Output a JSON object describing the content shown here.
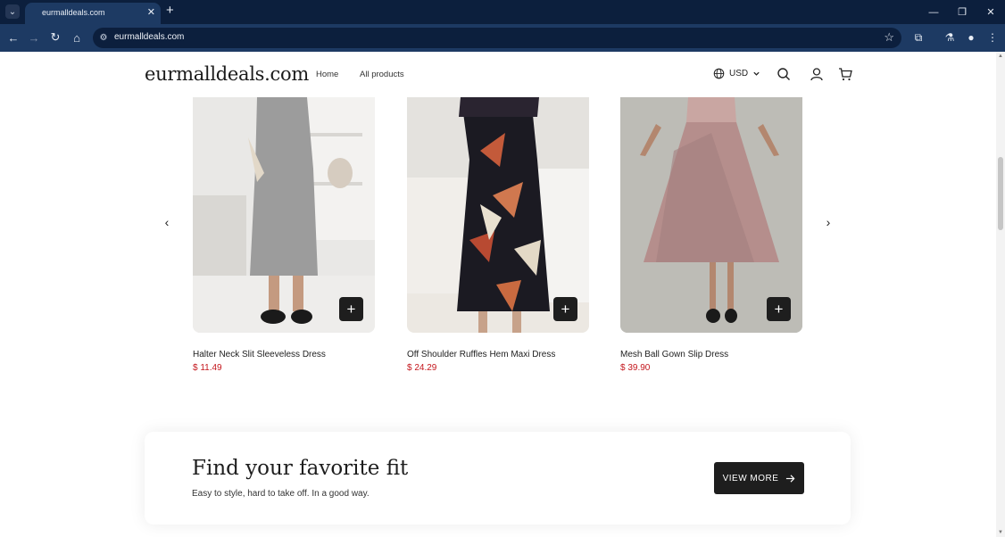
{
  "browser": {
    "tab_title": "eurmalldeals.com",
    "url": "eurmalldeals.com"
  },
  "header": {
    "logo": "eurmalldeals.com",
    "nav": [
      "Home",
      "All products"
    ],
    "currency": "USD"
  },
  "products": [
    {
      "name": "Halter Neck Slit Sleeveless Dress",
      "price": "$ 11.49"
    },
    {
      "name": "Off Shoulder Ruffles Hem Maxi Dress",
      "price": "$ 24.29"
    },
    {
      "name": "Mesh Ball Gown Slip Dress",
      "price": "$ 39.90"
    }
  ],
  "promo": {
    "title": "Find your favorite fit",
    "subtitle": "Easy to style, hard to take off. In a good way.",
    "button_label": "VIEW MORE"
  },
  "colors": {
    "chrome_dark": "#0c1f3d",
    "chrome_mid": "#1d3a63",
    "price_red": "#c4161c",
    "button_dark": "#1e1e1e"
  }
}
